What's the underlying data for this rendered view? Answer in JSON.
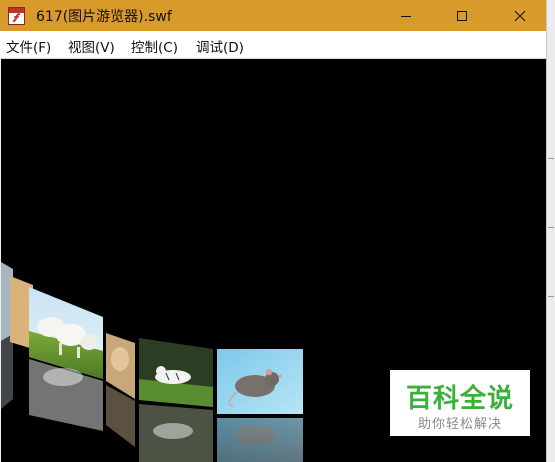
{
  "window": {
    "title": "617(图片游览器).swf",
    "controls": {
      "minimize": "minimize-icon",
      "maximize": "maximize-icon",
      "close": "close-icon"
    },
    "title_bar_color": "#d79a2b"
  },
  "menu": {
    "items": [
      {
        "label": "文件(F)"
      },
      {
        "label": "视图(V)"
      },
      {
        "label": "控制(C)"
      },
      {
        "label": "调试(D)"
      }
    ]
  },
  "stage": {
    "background": "#000000",
    "carousel_images": [
      {
        "subject": "partial-edge"
      },
      {
        "subject": "goats"
      },
      {
        "subject": "monkey"
      },
      {
        "subject": "white-tiger"
      },
      {
        "subject": "mouse"
      }
    ]
  },
  "watermark": {
    "title": "百科全说",
    "subtitle": "助你轻松解决",
    "color": "#3cae3c"
  }
}
